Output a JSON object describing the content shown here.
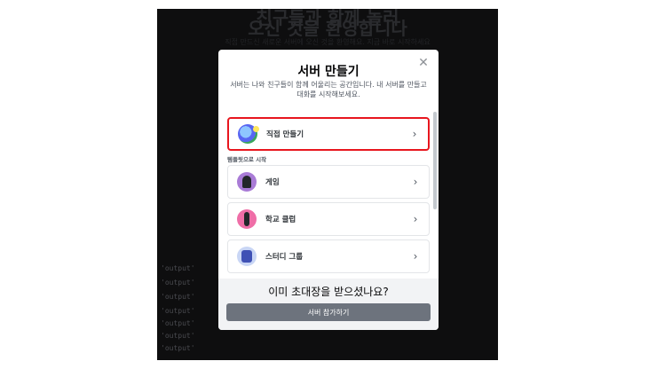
{
  "background": {
    "heading_line1": "친구들과 함께 놀러",
    "heading_line2": "오신 것을 환영합니다",
    "subtext": "직접 만드신 새로운 서버에 오신 것을 환영해요. 지금 바로 시작하세요",
    "log_lines": [
      "'output'",
      "'output'",
      "'output'",
      "'output'",
      "'output'",
      "'output'",
      "'output'"
    ]
  },
  "modal": {
    "title": "서버 만들기",
    "description": "서버는 나와 친구들이 함께 어울리는 공간입니다. 내 서버를 만들고 대화를 시작해보세요.",
    "create_own": {
      "label": "직접 만들기",
      "icon": "globe-icon"
    },
    "template_section_label": "템플릿으로 시작",
    "templates": [
      {
        "label": "게임",
        "icon": "gaming-icon"
      },
      {
        "label": "학교 클럽",
        "icon": "school-club-icon"
      },
      {
        "label": "스터디 그룹",
        "icon": "study-group-icon"
      }
    ],
    "footer": {
      "title": "이미 초대장을 받으셨나요?",
      "join_button": "서버 참가하기"
    }
  },
  "colors": {
    "highlight_border": "#e8161e",
    "join_button_bg": "#6d737d",
    "backdrop": "#0e0e0f"
  }
}
